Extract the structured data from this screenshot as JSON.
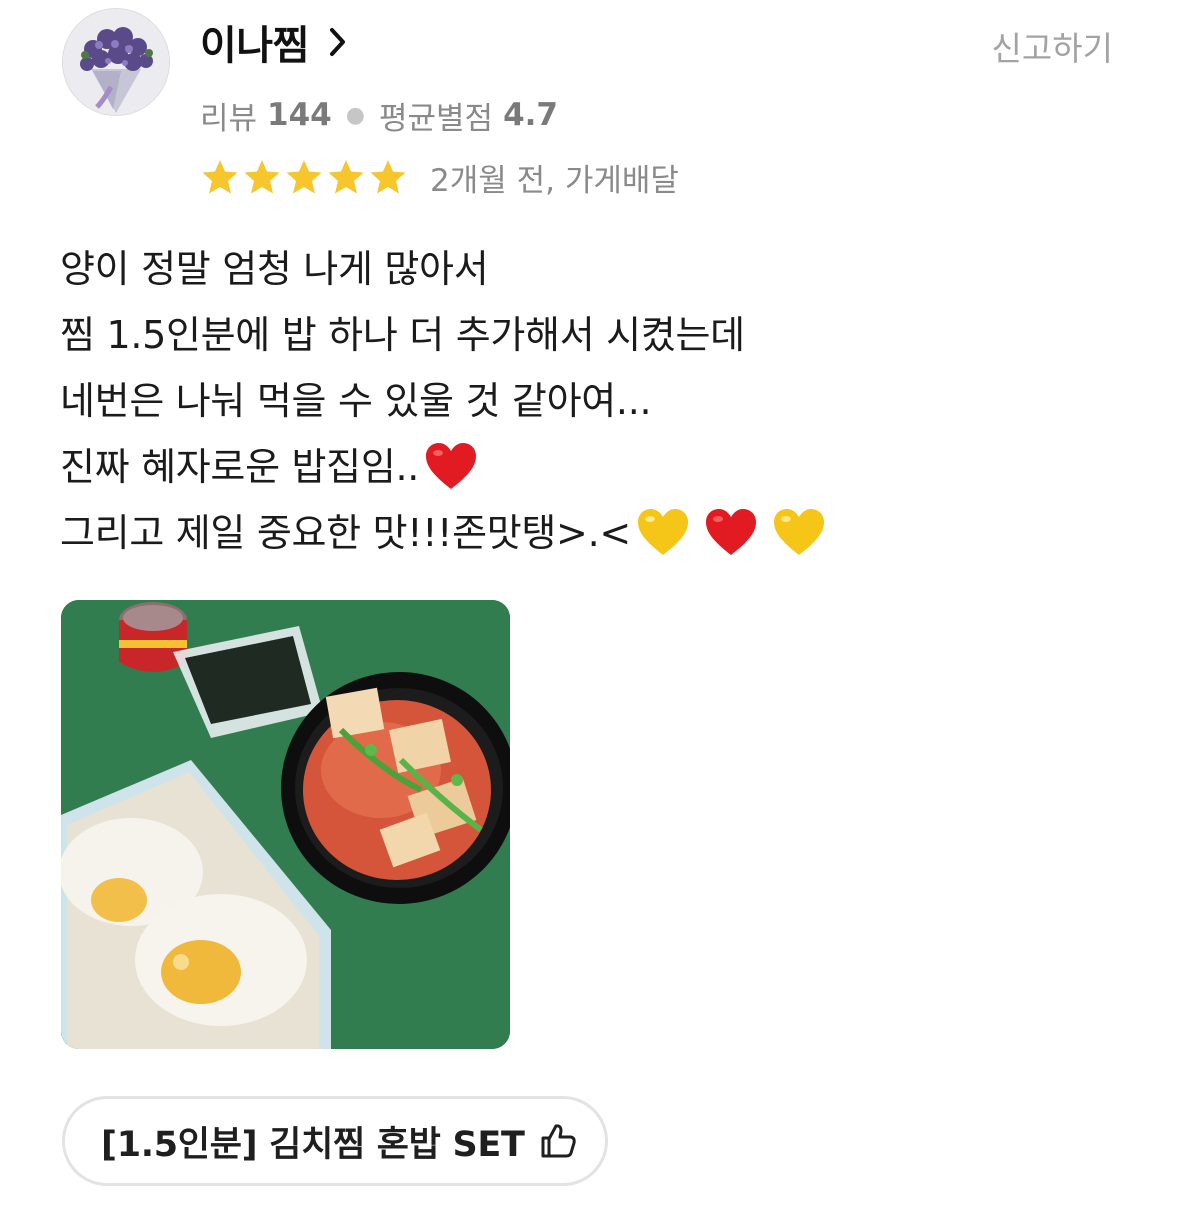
{
  "reviewer": {
    "name": "이나찜",
    "avatar_icon": "flower-bouquet-avatar",
    "review_count_label": "리뷰",
    "review_count": "144",
    "avg_rating_label": "평균별점",
    "avg_rating": "4.7"
  },
  "report_label": "신고하기",
  "rating": {
    "stars": 5,
    "max_stars": 5,
    "star_color": "#f7c52c"
  },
  "date_text": "2개월 전, 가게배달",
  "review_lines": [
    "양이 정말 엄청 나게 많아서",
    "찜 1.5인분에 밥 하나 더 추가해서 시켰는데",
    "네번은 나눠 먹을 수 있울 것 같아여...",
    "진짜 혜자로운 밥집임..",
    "그리고 제일 중요한 맛!!!존맛탱>.<"
  ],
  "review_emojis": {
    "line4": [
      "red-heart"
    ],
    "line5": [
      "yellow-heart",
      "red-heart",
      "yellow-heart"
    ]
  },
  "photo": {
    "icon": "food-photo-kimchi-jjim-rice"
  },
  "menu_item": {
    "label": "[1.5인분] 김치찜 혼밥 SET",
    "icon": "thumbs-up-icon"
  }
}
